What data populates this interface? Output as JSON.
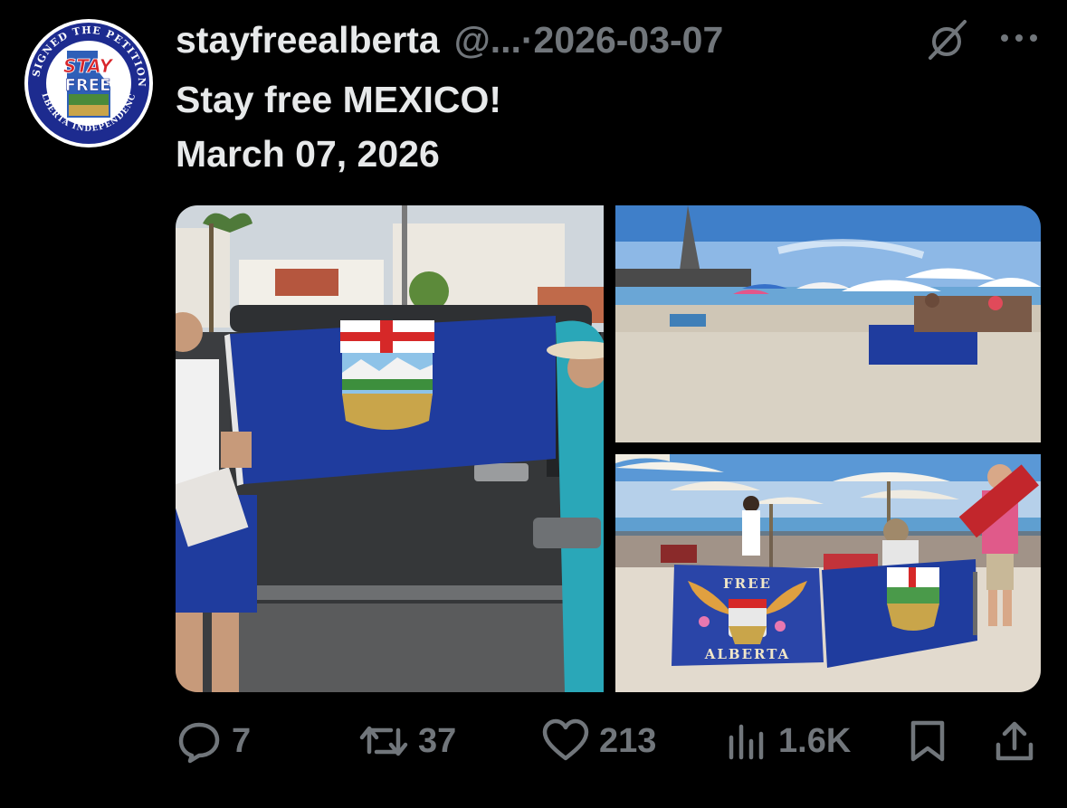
{
  "tweet": {
    "author": {
      "username": "stayfreealberta",
      "handle": "@...",
      "separator": "·",
      "date": "2026-03-07",
      "avatar": {
        "ring_text_top": "I SIGNED THE PETITION",
        "ring_text_bottom": "ALBERTA INDEPENDENCE",
        "center_text": [
          "STAY",
          "FREE"
        ],
        "colors": {
          "ring": "#1d2b8f",
          "border": "#ffffff"
        }
      }
    },
    "text_lines": [
      "Stay free MEXICO!",
      "March 07, 2026"
    ],
    "media": {
      "photos": [
        {
          "name": "flag-at-truck-photo",
          "flag_text": []
        },
        {
          "name": "beach-booth-photo",
          "flag_text": []
        },
        {
          "name": "beach-flags-photo",
          "flag_text": [
            "FREE",
            "ALBERTA"
          ]
        }
      ]
    },
    "actions": {
      "replies": {
        "icon": "reply-icon",
        "count": "7"
      },
      "reposts": {
        "icon": "repost-icon",
        "count": "37"
      },
      "likes": {
        "icon": "heart-icon",
        "count": "213"
      },
      "views": {
        "icon": "views-chart-icon",
        "count": "1.6K"
      },
      "bookmark": {
        "icon": "bookmark-icon"
      },
      "share": {
        "icon": "share-icon"
      }
    },
    "header_icons": {
      "grok": "grok-icon",
      "more": "more-icon"
    },
    "colors": {
      "background": "#000000",
      "primary_text": "#e7e9ea",
      "secondary_text": "#71767b",
      "flag_blue": "#1f3c9e"
    }
  }
}
